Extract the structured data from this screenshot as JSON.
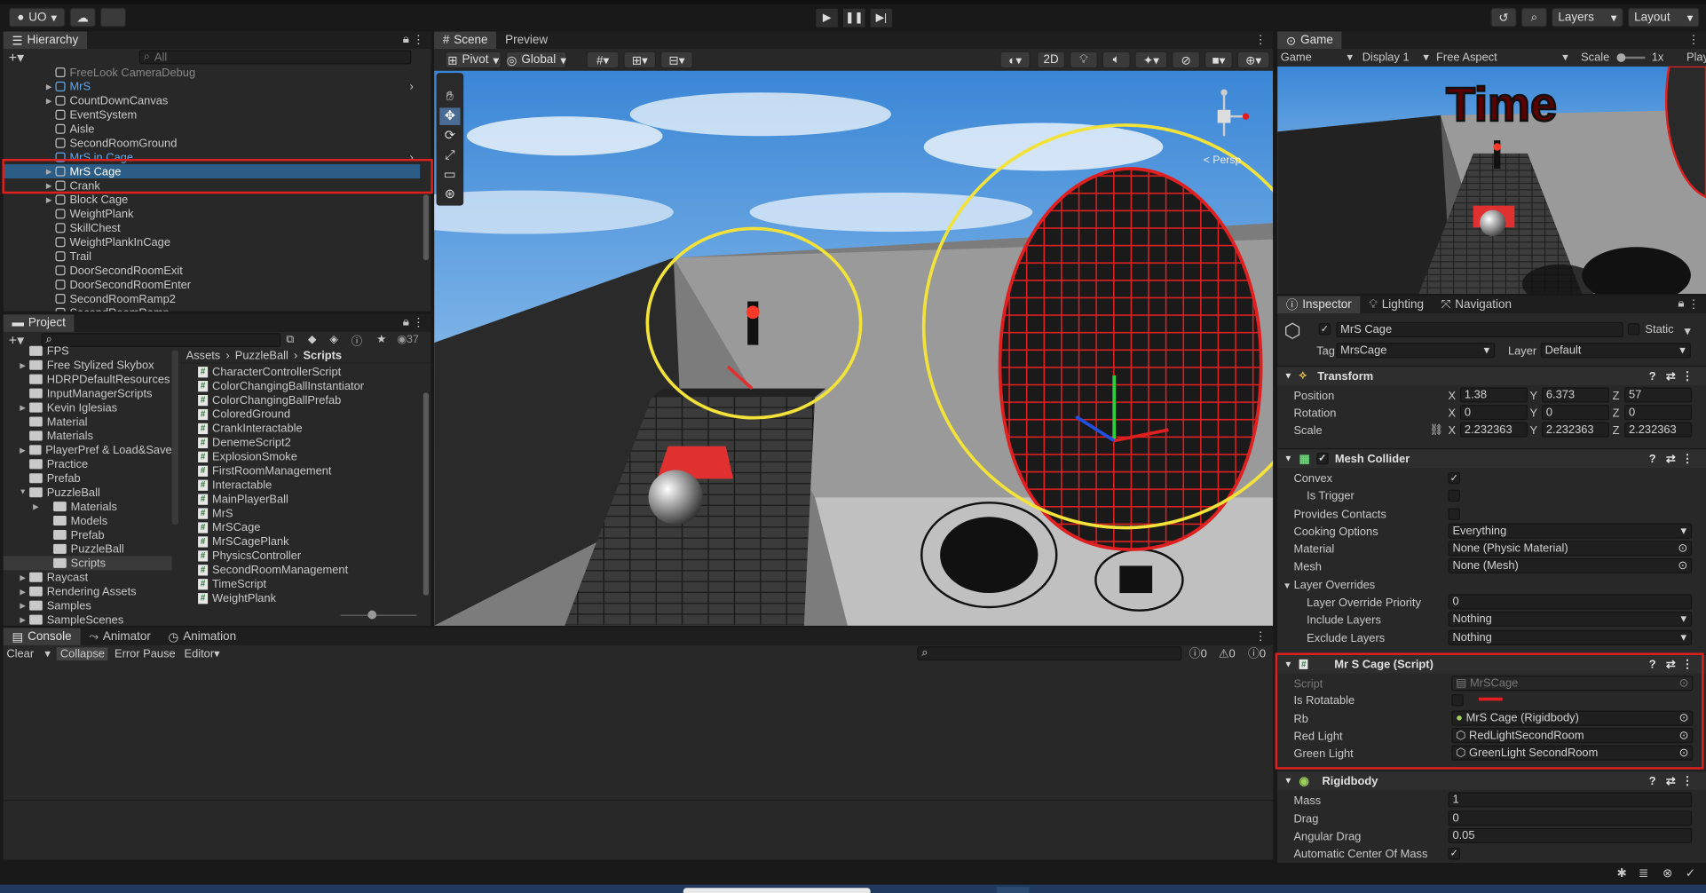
{
  "toolbar": {
    "account": "UO",
    "layers": "Layers",
    "layout": "Layout"
  },
  "hierarchy": {
    "title": "Hierarchy",
    "search_placeholder": "All",
    "items": [
      "FreeLook CameraDebug",
      "MrS",
      "CountDownCanvas",
      "EventSystem",
      "Aisle",
      "SecondRoomGround",
      "MrS in Cage",
      "MrS Cage",
      "Crank",
      "Block Cage",
      "WeightPlank",
      "SkillChest",
      "WeightPlankInCage",
      "Trail",
      "DoorSecondRoomExit",
      "DoorSecondRoomEnter",
      "SecondRoomRamp2",
      "SecondRoomRamp"
    ]
  },
  "project": {
    "title": "Project",
    "count": "37",
    "folders": [
      "FPS",
      "Free Stylized Skybox",
      "HDRPDefaultResources",
      "InputManagerScripts",
      "Kevin Iglesias",
      "Material",
      "Materials",
      "PlayerPref & Load&Save",
      "Practice",
      "Prefab",
      "PuzzleBall",
      "Materials",
      "Models",
      "Prefab",
      "PuzzleBall",
      "Scripts",
      "Raycast",
      "Rendering Assets",
      "Samples",
      "SampleScenes"
    ],
    "breadcrumb": [
      "Assets",
      "PuzzleBall",
      "Scripts"
    ],
    "scripts": [
      "CharacterControllerScript",
      "ColorChangingBallInstantiator",
      "ColorChangingBallPrefab",
      "ColoredGround",
      "CrankInteractable",
      "DenemeScript2",
      "ExplosionSmoke",
      "FirstRoomManagement",
      "Interactable",
      "MainPlayerBall",
      "MrS",
      "MrSCage",
      "MrSCagePlank",
      "PhysicsController",
      "SecondRoomManagement",
      "TimeScript",
      "WeightPlank"
    ]
  },
  "scene": {
    "tabs": [
      "Scene",
      "Preview"
    ],
    "pivot": "Pivot",
    "global": "Global",
    "mode2d": "2D",
    "persp": "< Persp"
  },
  "game": {
    "tab": "Game",
    "game_label": "Game",
    "display": "Display 1",
    "aspect": "Free Aspect",
    "scale_label": "Scale",
    "scale": "1x",
    "play": "Play",
    "overlay_text": "Time"
  },
  "console": {
    "tabs": [
      "Console",
      "Animator",
      "Animation"
    ],
    "buttons": [
      "Clear",
      "Collapse",
      "Error Pause",
      "Editor"
    ],
    "counts": [
      "0",
      "0",
      "0"
    ]
  },
  "inspector": {
    "tabs": [
      "Inspector",
      "Lighting",
      "Navigation"
    ],
    "object_name": "MrS Cage",
    "static_label": "Static",
    "tag_label": "Tag",
    "tag": "MrsCage",
    "layer_label": "Layer",
    "layer": "Default",
    "transform": {
      "title": "Transform",
      "rows": [
        {
          "label": "Position",
          "x": "1.38",
          "y": "6.373",
          "z": "57"
        },
        {
          "label": "Rotation",
          "x": "0",
          "y": "0",
          "z": "0"
        },
        {
          "label": "Scale",
          "x": "2.232363",
          "y": "2.232363",
          "z": "2.232363"
        }
      ]
    },
    "mesh_collider": {
      "title": "Mesh Collider",
      "convex": "Convex",
      "is_trigger": "Is Trigger",
      "provides_contacts": "Provides Contacts",
      "cooking_label": "Cooking Options",
      "cooking": "Everything",
      "material_label": "Material",
      "material": "None (Physic Material)",
      "mesh_label": "Mesh",
      "mesh": "None (Mesh)",
      "layer_overrides": "Layer Overrides",
      "priority_label": "Layer Override Priority",
      "priority": "0",
      "include_label": "Include Layers",
      "include": "Nothing",
      "exclude_label": "Exclude Layers",
      "exclude": "Nothing"
    },
    "script": {
      "title": "Mr S Cage (Script)",
      "script_label": "Script",
      "script": "MrSCage",
      "rotatable_label": "Is Rotatable",
      "rb_label": "Rb",
      "rb": "MrS Cage (Rigidbody)",
      "red_label": "Red Light",
      "red": "RedLightSecondRoom",
      "green_label": "Green Light",
      "green": "GreenLight SecondRoom"
    },
    "rigidbody": {
      "title": "Rigidbody",
      "mass_label": "Mass",
      "mass": "1",
      "drag_label": "Drag",
      "drag": "0",
      "angular_label": "Angular Drag",
      "angular": "0.05",
      "auto_com": "Automatic Center Of Mass"
    },
    "axes": {
      "x": "X",
      "y": "Y",
      "z": "Z"
    }
  },
  "colors": {
    "highlight": "#e0201c",
    "selection": "#2c5d87",
    "yellow": "#f2e23a"
  }
}
